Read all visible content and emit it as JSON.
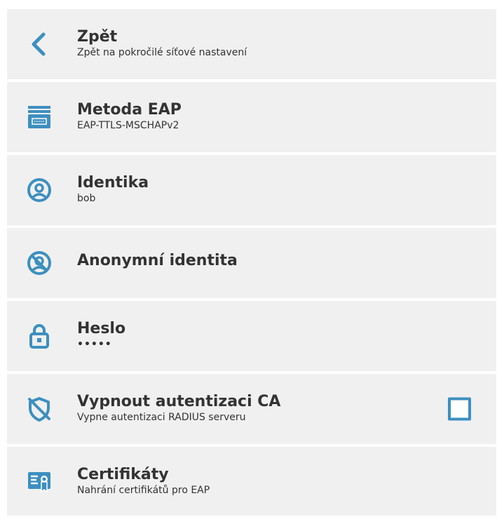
{
  "accent_color": "#3d8fc0",
  "items": [
    {
      "icon": "back-chevron-icon",
      "title": "Zpět",
      "subtitle": "Zpět na pokročilé síťové nastavení"
    },
    {
      "icon": "eap-method-icon",
      "title": "Metoda EAP",
      "subtitle": "EAP-TTLS-MSCHAPv2"
    },
    {
      "icon": "identity-icon",
      "title": "Identika",
      "subtitle": "bob"
    },
    {
      "icon": "anonymous-identity-icon",
      "title": "Anonymní identita",
      "subtitle": ""
    },
    {
      "icon": "lock-icon",
      "title": "Heslo",
      "subtitle": "•••••"
    },
    {
      "icon": "shield-off-icon",
      "title": "Vypnout autentizaci CA",
      "subtitle": "Vypne autentizaci RADIUS serveru",
      "checkbox_checked": false
    },
    {
      "icon": "certificate-icon",
      "title": "Certifikáty",
      "subtitle": "Nahrání certifikátů pro EAP"
    }
  ]
}
